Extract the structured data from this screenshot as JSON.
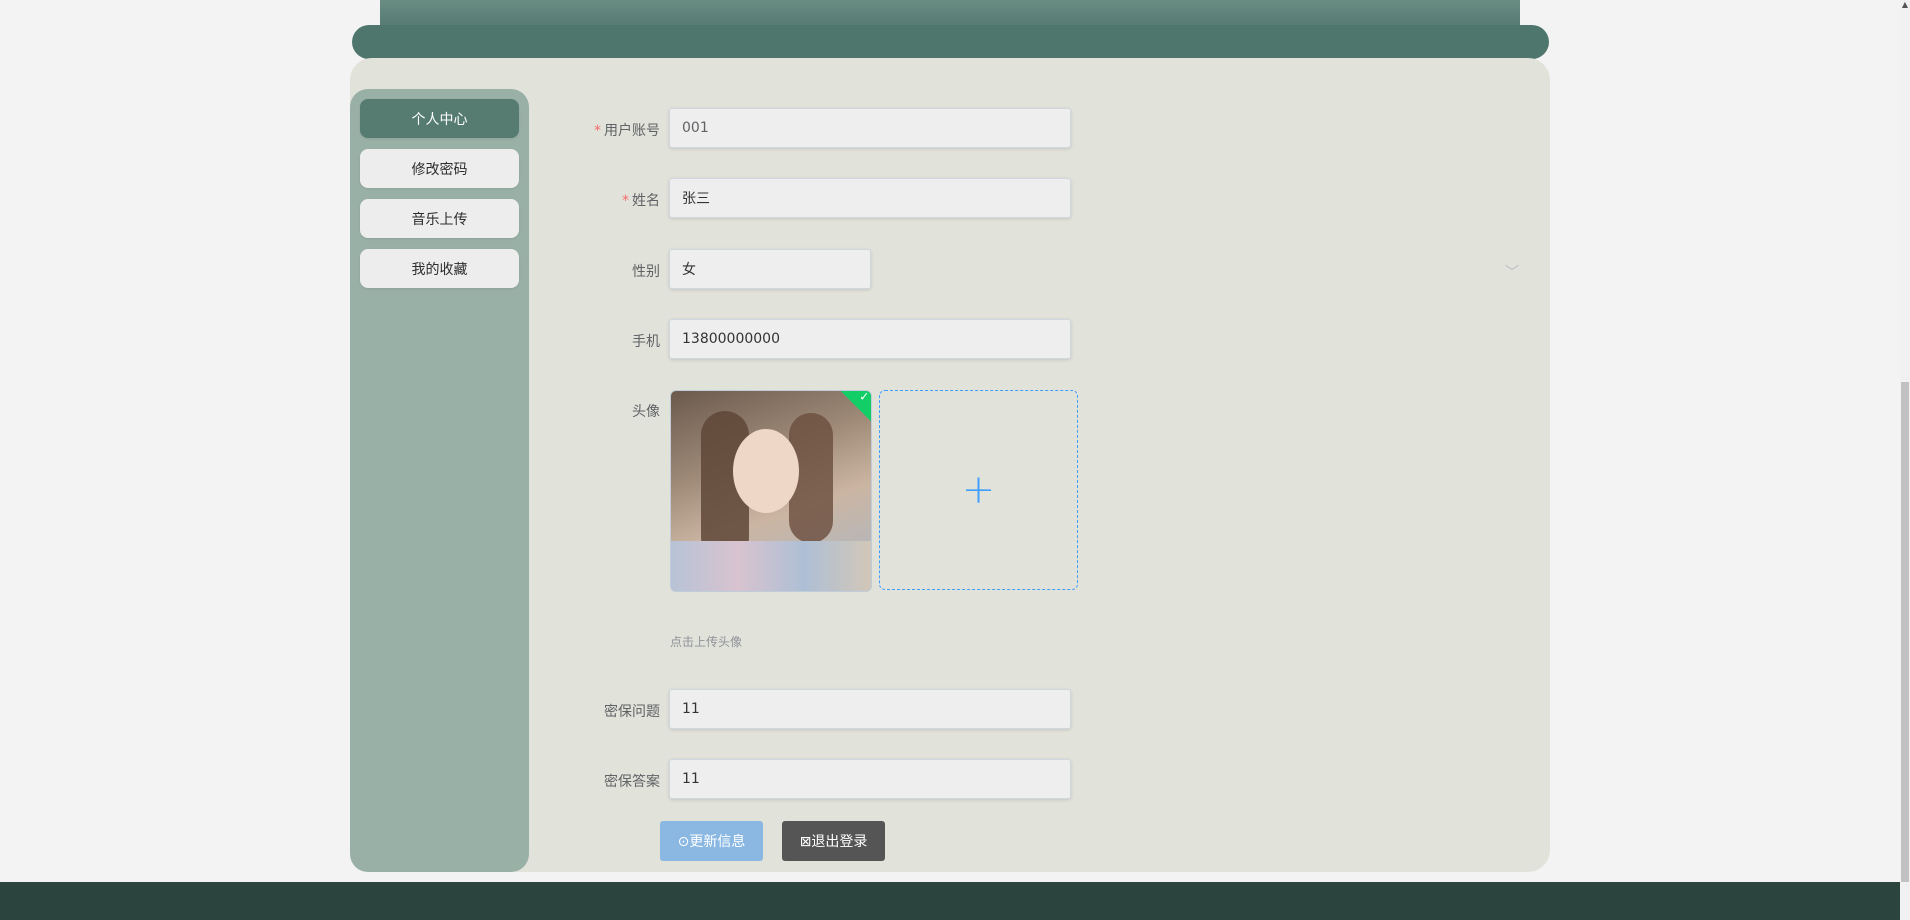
{
  "sidebar": {
    "items": [
      {
        "label": "个人中心",
        "active": true
      },
      {
        "label": "修改密码",
        "active": false
      },
      {
        "label": "音乐上传",
        "active": false
      },
      {
        "label": "我的收藏",
        "active": false
      }
    ]
  },
  "form": {
    "account": {
      "label": "用户账号",
      "required_mark": "*",
      "value": "001"
    },
    "name": {
      "label": "姓名",
      "required_mark": "*",
      "value": "张三"
    },
    "gender": {
      "label": "性别",
      "value": "女"
    },
    "phone": {
      "label": "手机",
      "value": "13800000000"
    },
    "avatar": {
      "label": "头像",
      "hint": "点击上传头像",
      "upload_icon": "+",
      "success_icon": "✓"
    },
    "security_question": {
      "label": "密保问题",
      "value": "11"
    },
    "security_answer": {
      "label": "密保答案",
      "value": "11"
    }
  },
  "actions": {
    "update_label": "⊙更新信息",
    "logout_label": "⊠退出登录"
  },
  "colors": {
    "accent": "#567c72",
    "sidebar": "#99b0a6",
    "footer": "#2b453e",
    "primary_button": "#8ab8e2",
    "upload_border": "#409eff"
  }
}
